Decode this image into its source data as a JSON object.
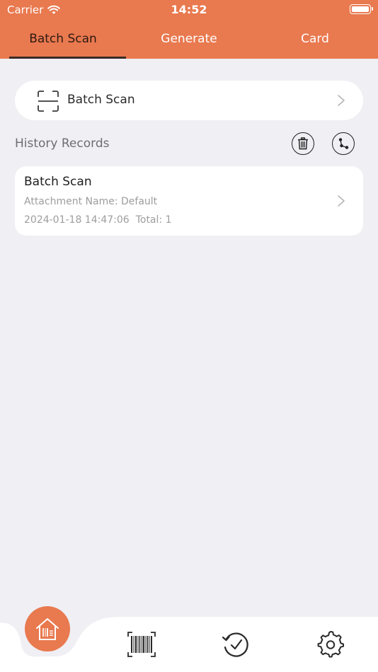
{
  "status_bar": {
    "carrier": "Carrier",
    "time": "14:52"
  },
  "tabs": [
    {
      "label": "Batch Scan",
      "active": true
    },
    {
      "label": "Generate",
      "active": false
    },
    {
      "label": "Card",
      "active": false
    }
  ],
  "scan_card": {
    "icon": "scan-frame-icon",
    "label": "Batch Scan"
  },
  "history": {
    "title": "History Records",
    "actions": [
      "trash-icon",
      "share-icon"
    ]
  },
  "records": [
    {
      "title": "Batch Scan",
      "attachment": "Attachment Name: Default",
      "datetime": "2024-01-18 14:47:06",
      "total": "Total: 1"
    }
  ],
  "bottom_nav": [
    "home-icon",
    "barcode-icon",
    "history-icon",
    "settings-icon"
  ],
  "colors": {
    "accent": "#e9794f",
    "background": "#efeff4",
    "card": "#ffffff"
  }
}
